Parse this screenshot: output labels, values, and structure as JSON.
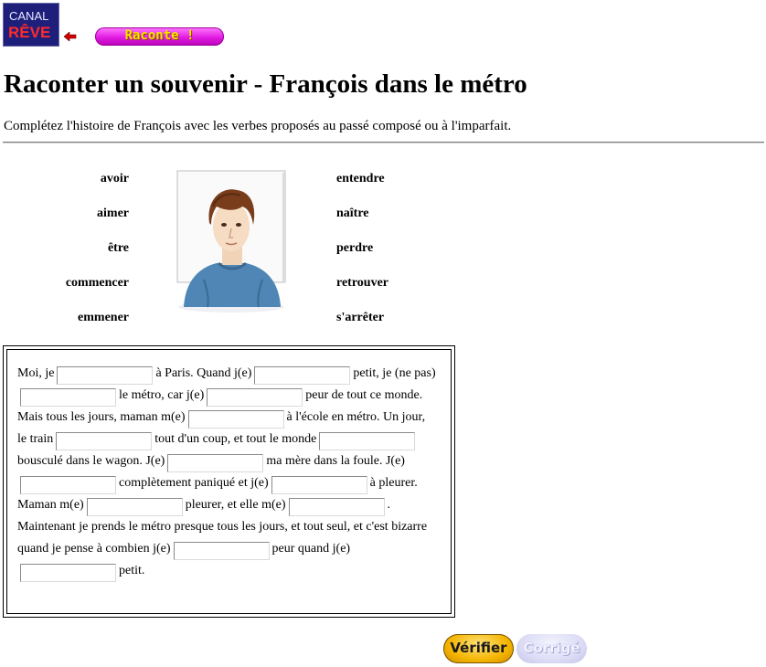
{
  "logo": {
    "line1": "CANAL",
    "line2": "RÊVE"
  },
  "nav": {
    "raconte_label": "Raconte !"
  },
  "page": {
    "title": "Raconter un souvenir - François dans le métro",
    "instructions": "Complétez l'histoire de François avec les verbes proposés au passé composé ou à l'imparfait."
  },
  "verbs_left": [
    "avoir",
    "aimer",
    "être",
    "commencer",
    "emmener"
  ],
  "verbs_right": [
    "entendre",
    "naître",
    "perdre",
    "retrouver",
    "s'arrêter"
  ],
  "exercise": {
    "segments": [
      "Moi, je",
      "à Paris. Quand j(e)",
      "petit, je (ne pas)",
      "le métro, car j(e)",
      "peur de tout ce monde. Mais tous les jours, maman m(e)",
      "à l'école en métro. Un jour, le train",
      "tout d'un coup, et tout le monde",
      "bousculé dans le wagon. J(e)",
      "ma mère dans la foule. J(e)",
      "complètement paniqué et j(e)",
      "à pleurer. Maman m(e)",
      "pleurer, et elle m(e)",
      ". Maintenant je prends le métro presque tous les jours, et tout seul, et c'est bizarre quand je pense à combien j(e)",
      "peur quand j(e)",
      "petit."
    ],
    "blanks": [
      "",
      "",
      "",
      "",
      "",
      "",
      "",
      "",
      "",
      "",
      "",
      "",
      "",
      ""
    ]
  },
  "buttons": {
    "verifier": "Vérifier",
    "corrige": "Corrigé"
  },
  "colors": {
    "logo_bg": "#1e1f7a",
    "raconte_bg": "#e21be2",
    "raconte_text": "#ffe100",
    "verifier_bg": "#f4b400",
    "corrige_bg": "#dcdcf6"
  }
}
